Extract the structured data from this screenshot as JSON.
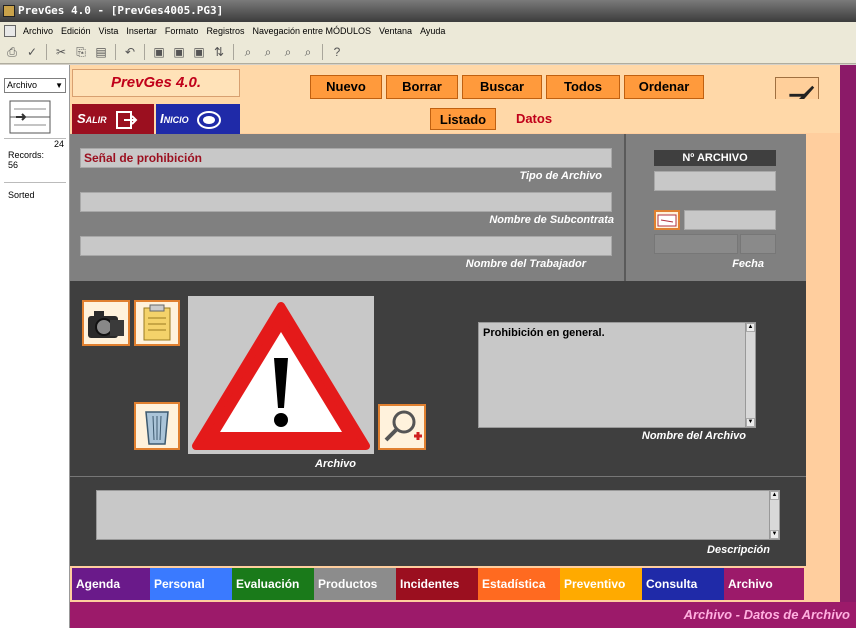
{
  "window": {
    "title": "PrevGes 4.0 - [PrevGes4005.PG3]"
  },
  "menubar": {
    "items": [
      "Archivo",
      "Edición",
      "Vista",
      "Insertar",
      "Formato",
      "Registros",
      "Navegación entre MÓDULOS",
      "Ventana",
      "Ayuda"
    ]
  },
  "leftpane": {
    "layout_label": "Archivo",
    "record_number": "24",
    "records_label": "Records:",
    "records_count": "56",
    "sorted_label": "Sorted"
  },
  "header": {
    "brand": "PrevGes 4.0.",
    "buttons": {
      "nuevo": "Nuevo",
      "borrar": "Borrar",
      "buscar": "Buscar",
      "todos": "Todos",
      "ordenar": "Ordenar"
    },
    "salir": "Salir",
    "inicio": "Inicio",
    "tabs": {
      "listado": "Listado",
      "datos": "Datos"
    }
  },
  "form": {
    "tipo_value": "Señal de prohibición",
    "tipo_label": "Tipo de Archivo",
    "subcontrata_value": "",
    "subcontrata_label": "Nombre de Subcontrata",
    "trabajador_value": "",
    "trabajador_label": "Nombre del Trabajador",
    "numero_header": "Nº ARCHIVO",
    "numero_value": "",
    "fecha_value": "",
    "fecha_label": "Fecha",
    "imagen_label": "Archivo",
    "nombre_value": "Prohibición en general.",
    "nombre_label": "Nombre del Archivo",
    "descripcion_value": "",
    "descripcion_label": "Descripción"
  },
  "nav": [
    {
      "label": "Agenda",
      "color": "#6a1a8a"
    },
    {
      "label": "Personal",
      "color": "#3a7aff"
    },
    {
      "label": "Evaluación",
      "color": "#1a7a1a"
    },
    {
      "label": "Productos",
      "color": "#8c8c8c"
    },
    {
      "label": "Incidentes",
      "color": "#9b0f1f"
    },
    {
      "label": "Estadística",
      "color": "#ff6a20"
    },
    {
      "label": "Preventivo",
      "color": "#ffaa00"
    },
    {
      "label": "Consulta",
      "color": "#1f2aa8"
    },
    {
      "label": "Archivo",
      "color": "#9c1a6a"
    }
  ],
  "status": {
    "text": "Archivo - Datos de Archivo"
  }
}
